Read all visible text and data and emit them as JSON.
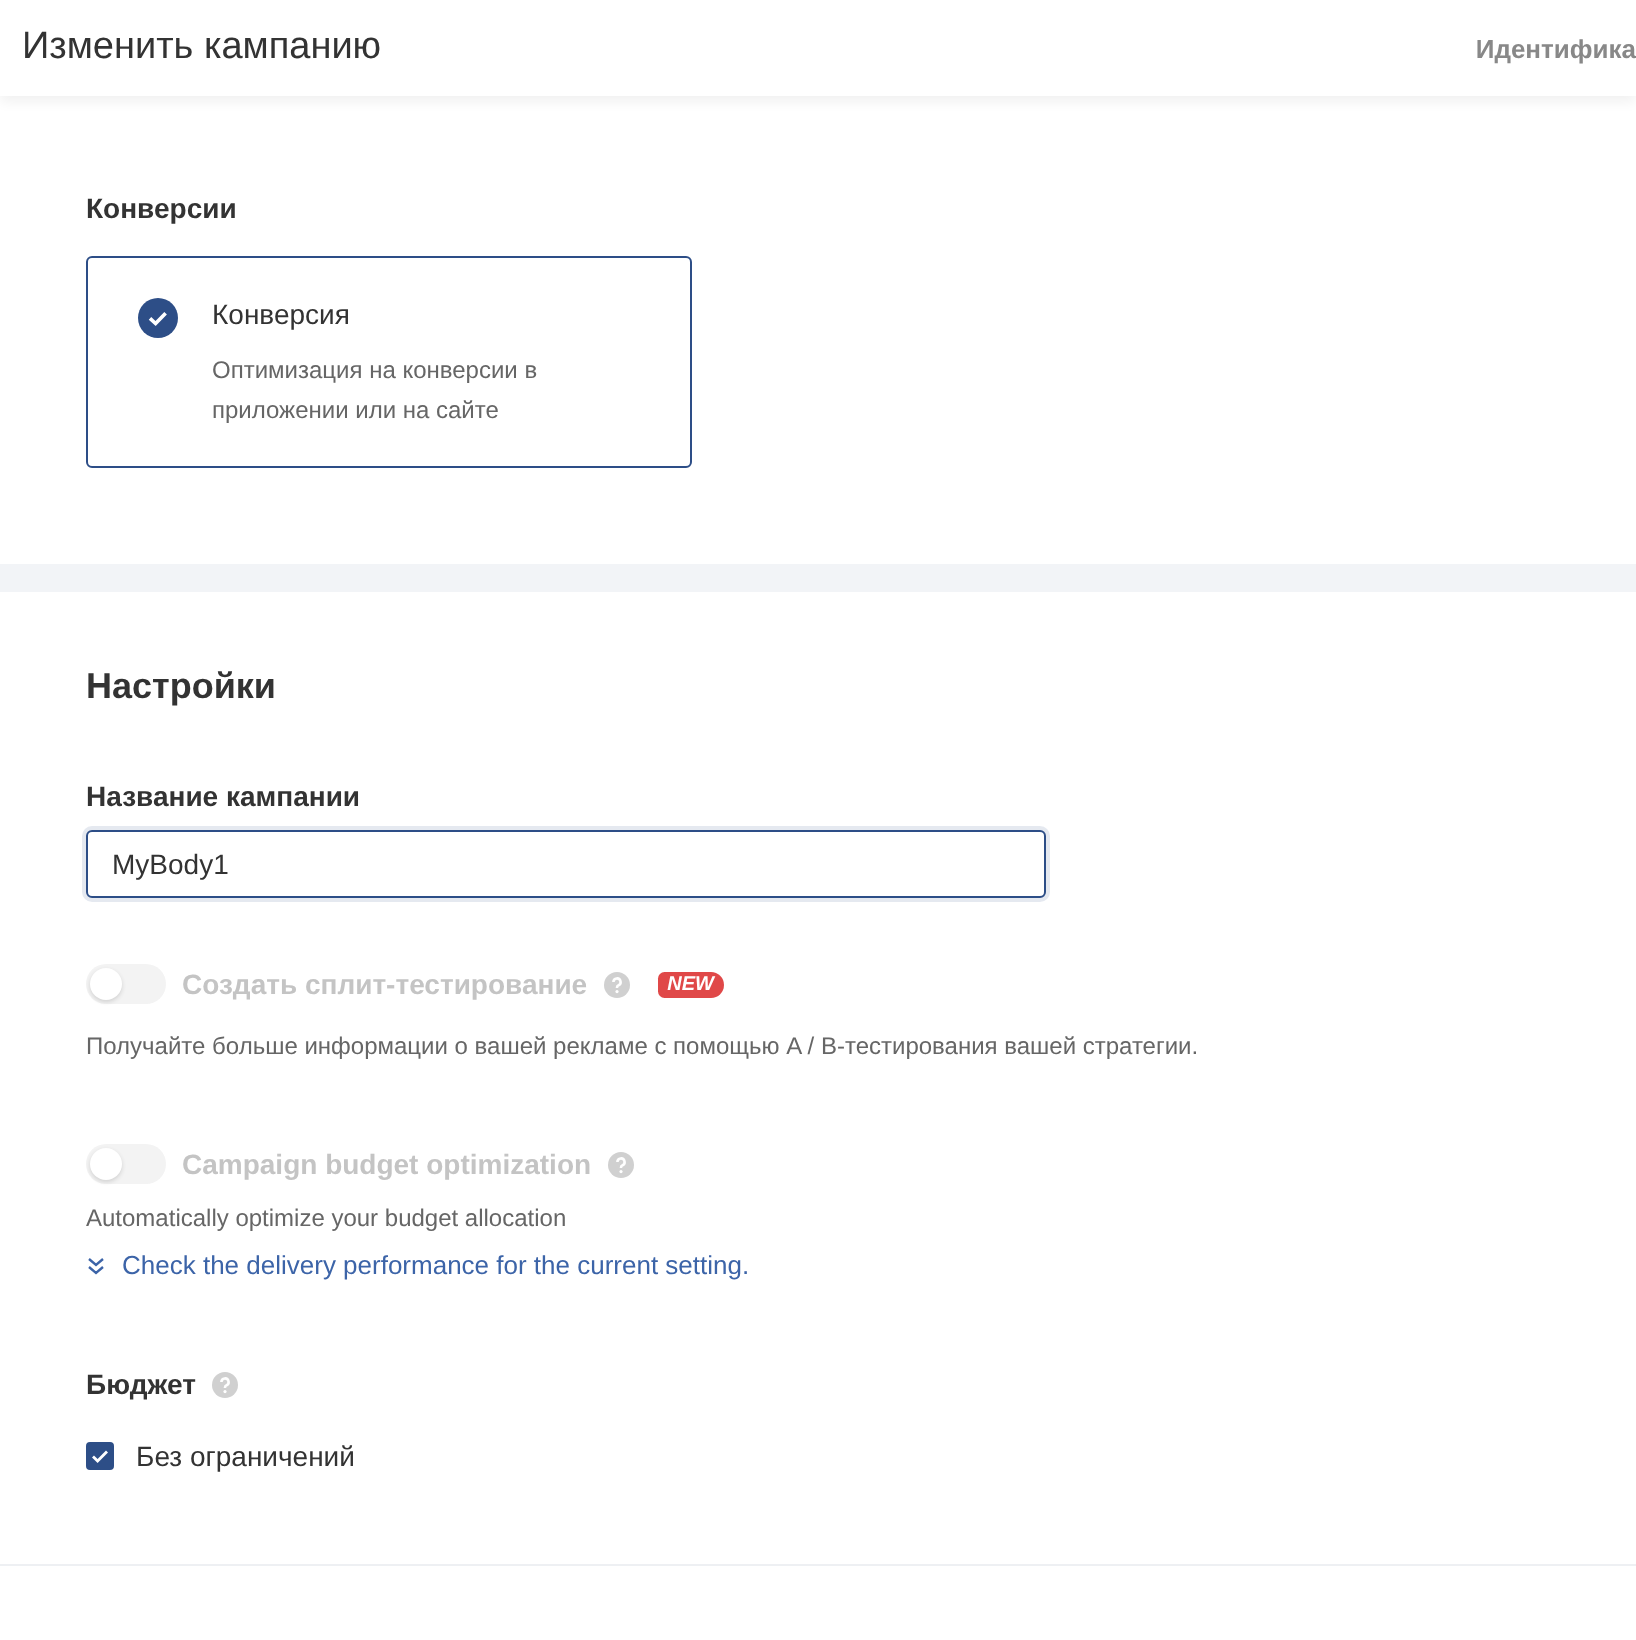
{
  "header": {
    "title": "Изменить кампанию",
    "side_text": "Идентифика"
  },
  "conversions": {
    "title": "Конверсии",
    "options": [
      {
        "title": "Конверсия",
        "description": "Оптимизация на конверсии в приложении или на сайте",
        "selected": true
      }
    ]
  },
  "settings": {
    "title": "Настройки",
    "campaign_name": {
      "label": "Название кампании",
      "value": "MyBody1"
    },
    "toggles": [
      {
        "label": "Создать сплит-тестирование",
        "on": false,
        "disabled": true,
        "badge": "NEW",
        "description": "Получайте больше информации о вашей рекламе с помощью A / B-тестирования вашей стратегии."
      },
      {
        "label": "Campaign budget optimization",
        "on": false,
        "disabled": true,
        "description": "Automatically optimize your budget allocation",
        "link": "Check the delivery performance for the current setting."
      }
    ],
    "budget": {
      "label": "Бюджет",
      "checkbox": {
        "label": "Без ограничений",
        "checked": true
      }
    }
  }
}
